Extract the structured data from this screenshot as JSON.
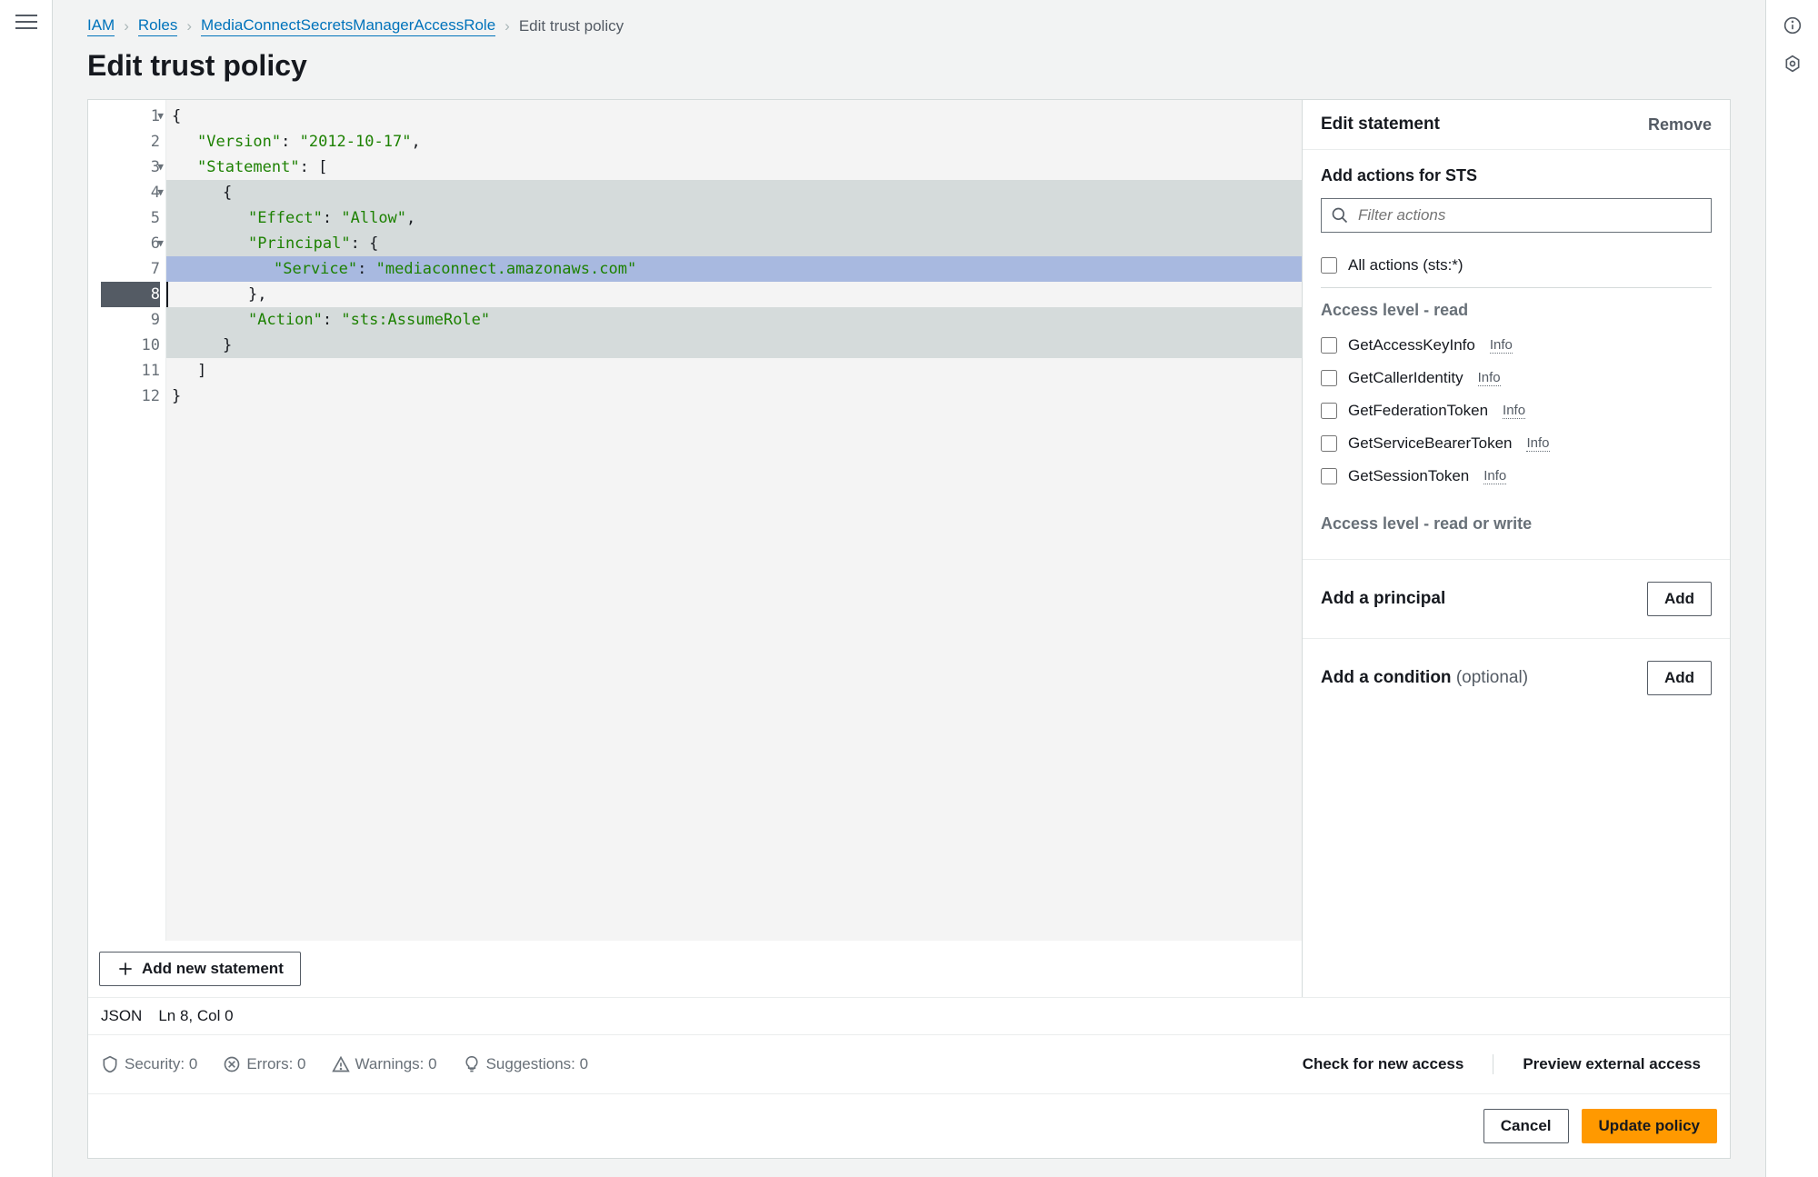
{
  "breadcrumb": {
    "items": [
      {
        "label": "IAM",
        "link": true
      },
      {
        "label": "Roles",
        "link": true
      },
      {
        "label": "MediaConnectSecretsManagerAccessRole",
        "link": true
      },
      {
        "label": "Edit trust policy",
        "link": false
      }
    ]
  },
  "page_title": "Edit trust policy",
  "editor": {
    "lines": [
      {
        "n": 1,
        "fold": true
      },
      {
        "n": 2
      },
      {
        "n": 3,
        "fold": true
      },
      {
        "n": 4,
        "fold": true,
        "sel": true
      },
      {
        "n": 5,
        "sel": true
      },
      {
        "n": 6,
        "fold": true,
        "sel": true
      },
      {
        "n": 7,
        "hl": true
      },
      {
        "n": 8,
        "active": true
      },
      {
        "n": 9,
        "sel": true
      },
      {
        "n": 10,
        "sel": true
      },
      {
        "n": 11
      },
      {
        "n": 12
      }
    ],
    "json_tokens": {
      "l1": "{",
      "l2_k": "\"Version\"",
      "l2_v": "\"2012-10-17\"",
      "l3_k": "\"Statement\"",
      "l3_p": "[",
      "l4": "{",
      "l5_k": "\"Effect\"",
      "l5_v": "\"Allow\"",
      "l6_k": "\"Principal\"",
      "l6_p": "{",
      "l7_k": "\"Service\"",
      "l7_v": "\"mediaconnect.amazonaws.com\"",
      "l8": "},",
      "l9_k": "\"Action\"",
      "l9_v": "\"sts:AssumeRole\"",
      "l10": "}",
      "l11": "]",
      "l12": "}"
    },
    "add_statement_label": "Add new statement",
    "status": {
      "mode": "JSON",
      "pos": "Ln 8, Col 0"
    },
    "validation": {
      "security": "Security: 0",
      "errors": "Errors: 0",
      "warnings": "Warnings: 0",
      "suggestions": "Suggestions: 0",
      "check_new_access": "Check for new access",
      "preview_external": "Preview external access"
    }
  },
  "side": {
    "edit_statement": "Edit statement",
    "remove": "Remove",
    "add_actions_for": "Add actions for STS",
    "filter_placeholder": "Filter actions",
    "all_actions": "All actions (sts:*)",
    "level_read": "Access level - read",
    "read_actions": [
      "GetAccessKeyInfo",
      "GetCallerIdentity",
      "GetFederationToken",
      "GetServiceBearerToken",
      "GetSessionToken"
    ],
    "info": "Info",
    "level_read_write": "Access level - read or write",
    "add_principal": "Add a principal",
    "add_condition": "Add a condition",
    "optional": "(optional)",
    "add_btn": "Add"
  },
  "footer": {
    "cancel": "Cancel",
    "update": "Update policy"
  }
}
